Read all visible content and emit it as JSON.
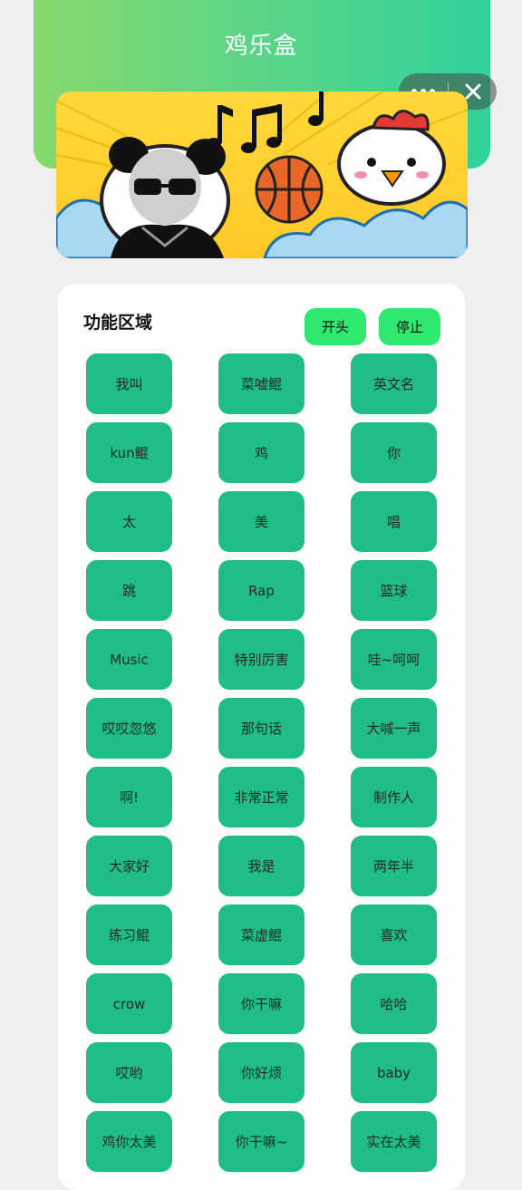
{
  "header": {
    "title": "鸡乐盒"
  },
  "capsule": {
    "more_icon": "ellipsis-icon",
    "close_icon": "close-icon"
  },
  "banner": {
    "description_icons": [
      "music-notes-icon",
      "basketball-icon",
      "chicken-icon",
      "panda-icon"
    ]
  },
  "panel": {
    "title": "功能区域",
    "start_label": "开头",
    "stop_label": "停止"
  },
  "buttons": [
    {
      "label": "我叫"
    },
    {
      "label": "菜嘘鲲"
    },
    {
      "label": "英文名"
    },
    {
      "label": "kun鲲"
    },
    {
      "label": "鸡"
    },
    {
      "label": "你"
    },
    {
      "label": "太"
    },
    {
      "label": "美"
    },
    {
      "label": "唱"
    },
    {
      "label": "跳"
    },
    {
      "label": "Rap"
    },
    {
      "label": "篮球"
    },
    {
      "label": "Music"
    },
    {
      "label": "特别厉害"
    },
    {
      "label": "哇~呵呵"
    },
    {
      "label": "哎哎忽悠"
    },
    {
      "label": "那句话"
    },
    {
      "label": "大喊一声"
    },
    {
      "label": "啊!"
    },
    {
      "label": "非常正常"
    },
    {
      "label": "制作人"
    },
    {
      "label": "大家好"
    },
    {
      "label": "我是"
    },
    {
      "label": "两年半"
    },
    {
      "label": "练习鲲"
    },
    {
      "label": "菜虚鲲"
    },
    {
      "label": "喜欢"
    },
    {
      "label": "crow"
    },
    {
      "label": "你干嘛"
    },
    {
      "label": "哈哈"
    },
    {
      "label": "哎哟"
    },
    {
      "label": "你好烦"
    },
    {
      "label": "baby"
    },
    {
      "label": "鸡你太美"
    },
    {
      "label": "你干嘛~"
    },
    {
      "label": "实在太美"
    }
  ],
  "colors": {
    "accent_button": "#2ee86f",
    "tile": "#21bd87",
    "header_start": "#86d96c",
    "header_end": "#2fd29a"
  }
}
